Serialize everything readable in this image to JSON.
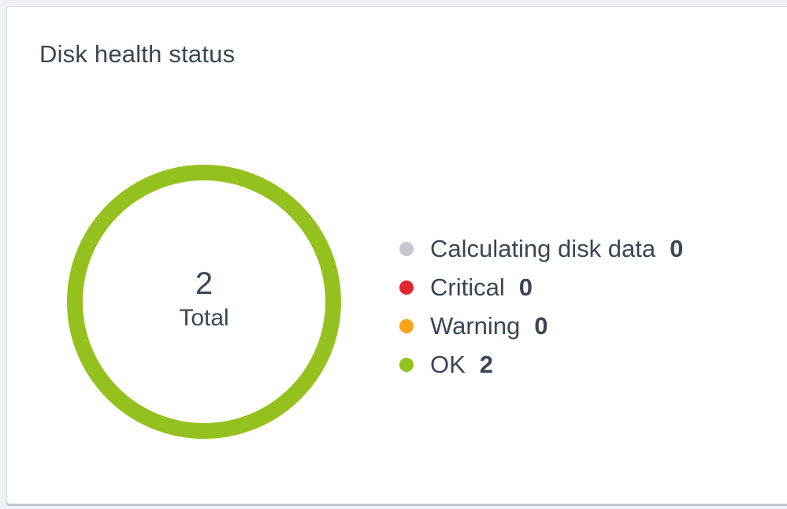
{
  "widget": {
    "title": "Disk health status"
  },
  "donut": {
    "total_value": "2",
    "total_label": "Total"
  },
  "chart_data": {
    "type": "pie",
    "categories": [
      "Calculating disk data",
      "Critical",
      "Warning",
      "OK"
    ],
    "values": [
      0,
      0,
      0,
      2
    ],
    "colors": [
      "#c5c8cc",
      "#e0282e",
      "#f9a21a",
      "#95c11f"
    ],
    "total": 2
  },
  "legend": {
    "items": [
      {
        "label": "Calculating disk data",
        "count": "0",
        "color": "#c5c8cc"
      },
      {
        "label": "Critical",
        "count": "0",
        "color": "#e0282e"
      },
      {
        "label": "Warning",
        "count": "0",
        "color": "#f9a21a"
      },
      {
        "label": "OK",
        "count": "2",
        "color": "#95c11f"
      }
    ]
  }
}
